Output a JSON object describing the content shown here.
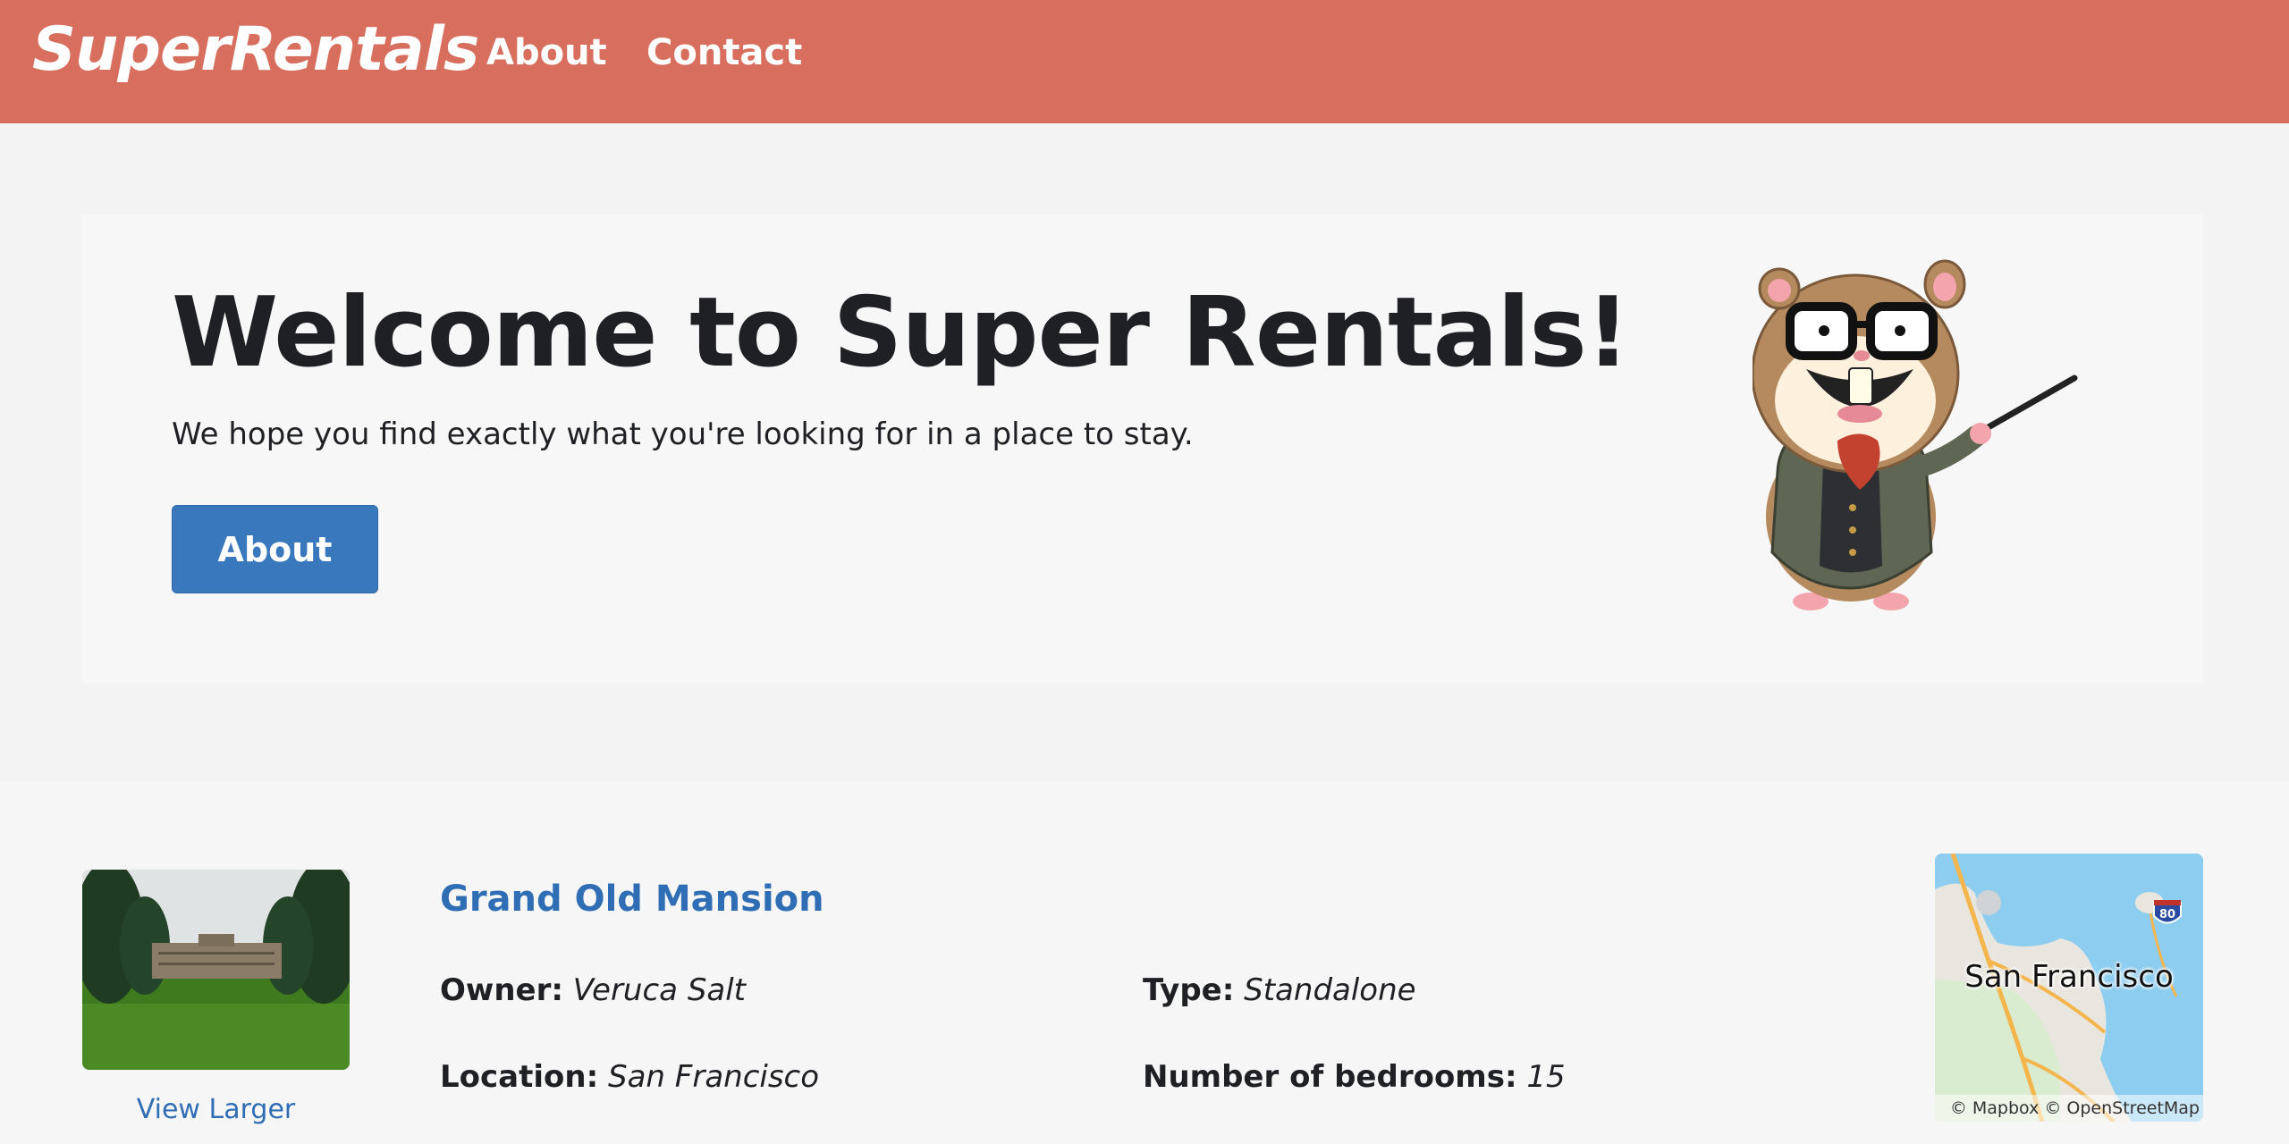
{
  "header": {
    "brand": "SuperRentals",
    "nav": [
      {
        "label": "About"
      },
      {
        "label": "Contact"
      }
    ],
    "bar_color": "#d86f5e"
  },
  "hero": {
    "title": "Welcome to Super Rentals!",
    "subtitle": "We hope you find exactly what you're looking for in a place to stay.",
    "button_label": "About",
    "button_color": "#3a78be",
    "mascot_icon": "tomster-hamster-with-pointer"
  },
  "rental": {
    "title": "Grand Old Mansion",
    "view_larger": "View Larger",
    "owner_label": "Owner:",
    "owner": "Veruca Salt",
    "type_label": "Type:",
    "type": "Standalone",
    "location_label": "Location:",
    "location": "San Francisco",
    "bedrooms_label": "Number of bedrooms:",
    "bedrooms": "15",
    "map": {
      "label": "San Francisco",
      "shield": "80",
      "attribution": "© Mapbox © OpenStreetMap"
    },
    "link_color": "#2f6db5"
  }
}
